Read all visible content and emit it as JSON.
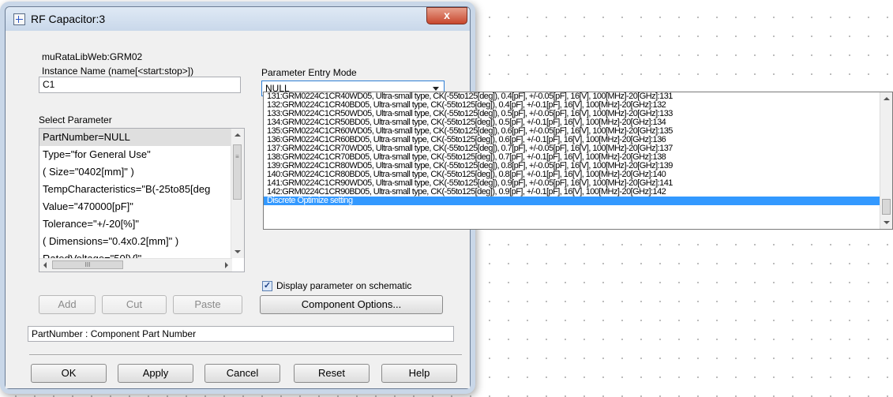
{
  "window": {
    "title": "RF Capacitor:3",
    "close_label": "x"
  },
  "dialog": {
    "library_label": "muRataLibWeb:GRM02",
    "instance_name_label": "Instance Name  (name[<start:stop>])",
    "instance_name_value": "C1",
    "select_parameter_label": "Select Parameter",
    "parameters": [
      "PartNumber=NULL",
      "Type=\"for General Use\"",
      "( Size=\"0402[mm]\" )",
      "TempCharacteristics=\"B(-25to85[deg",
      "Value=\"470000[pF]\"",
      "Tolerance=\"+/-20[%]\"",
      "( Dimensions=\"0.4x0.2[mm]\" )",
      "RatedVoltage=\"50[V]\""
    ],
    "parameter_entry_mode_label": "Parameter Entry Mode",
    "parameter_entry_mode_value": "NULL",
    "display_on_schematic_label": "Display parameter on schematic",
    "display_on_schematic_checked": true,
    "component_options_label": "Component Options...",
    "add_label": "Add",
    "cut_label": "Cut",
    "paste_label": "Paste",
    "description": "PartNumber : Component Part Number",
    "ok_label": "OK",
    "apply_label": "Apply",
    "cancel_label": "Cancel",
    "reset_label": "Reset",
    "help_label": "Help",
    "hscroll_glyph": "III",
    "scroll_glyph": "≡"
  },
  "dropdown": {
    "options": [
      "131:GRM0224C1CR40WD05, Ultra-small type, CK(-55to125[deg]), 0.4[pF], +/-0.05[pF], 16[V], 100[MHz]-20[GHz]:131",
      "132:GRM0224C1CR40BD05, Ultra-small type, CK(-55to125[deg]), 0.4[pF], +/-0.1[pF], 16[V], 100[MHz]-20[GHz]:132",
      "133:GRM0224C1CR50WD05, Ultra-small type, CK(-55to125[deg]), 0.5[pF], +/-0.05[pF], 16[V], 100[MHz]-20[GHz]:133",
      "134:GRM0224C1CR50BD05, Ultra-small type, CK(-55to125[deg]), 0.5[pF], +/-0.1[pF], 16[V], 100[MHz]-20[GHz]:134",
      "135:GRM0224C1CR60WD05, Ultra-small type, CK(-55to125[deg]), 0.6[pF], +/-0.05[pF], 16[V], 100[MHz]-20[GHz]:135",
      "136:GRM0224C1CR60BD05, Ultra-small type, CK(-55to125[deg]), 0.6[pF], +/-0.1[pF], 16[V], 100[MHz]-20[GHz]:136",
      "137:GRM0224C1CR70WD05, Ultra-small type, CK(-55to125[deg]), 0.7[pF], +/-0.05[pF], 16[V], 100[MHz]-20[GHz]:137",
      "138:GRM0224C1CR70BD05, Ultra-small type, CK(-55to125[deg]), 0.7[pF], +/-0.1[pF], 16[V], 100[MHz]-20[GHz]:138",
      "139:GRM0224C1CR80WD05, Ultra-small type, CK(-55to125[deg]), 0.8[pF], +/-0.05[pF], 16[V], 100[MHz]-20[GHz]:139",
      "140:GRM0224C1CR80BD05, Ultra-small type, CK(-55to125[deg]), 0.8[pF], +/-0.1[pF], 16[V], 100[MHz]-20[GHz]:140",
      "141:GRM0224C1CR90WD05, Ultra-small type, CK(-55to125[deg]), 0.9[pF], +/-0.05[pF], 16[V], 100[MHz]-20[GHz]:141",
      "142:GRM0224C1CR90BD05, Ultra-small type, CK(-55to125[deg]), 0.9[pF], +/-0.1[pF], 16[V], 100[MHz]-20[GHz]:142"
    ],
    "highlighted_option": "Discrete Optimize setting"
  },
  "colors": {
    "highlight": "#3399ff",
    "close_button": "#c7472e",
    "title_bar": "#c9d8ea"
  }
}
